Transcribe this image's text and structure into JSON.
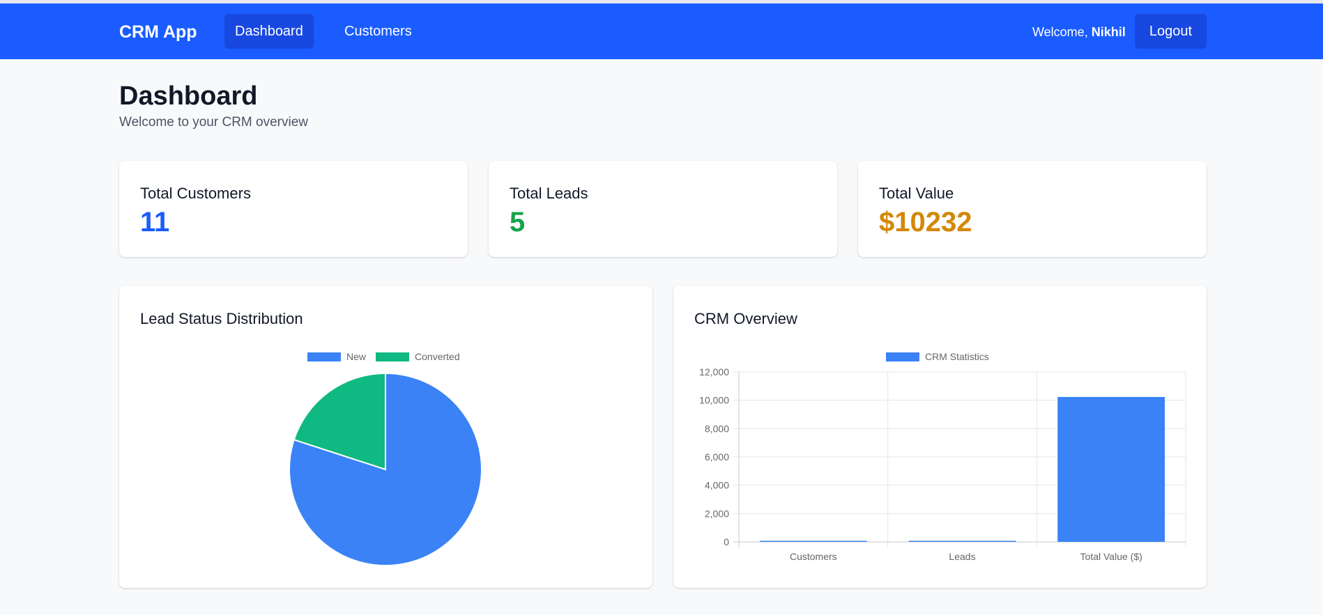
{
  "app": {
    "brand": "CRM App",
    "nav": {
      "dashboard": "Dashboard",
      "customers": "Customers"
    },
    "welcome_prefix": "Welcome,",
    "user_name": "Nikhil",
    "logout_label": "Logout"
  },
  "page": {
    "title": "Dashboard",
    "subtitle": "Welcome to your CRM overview"
  },
  "stats": {
    "customers": {
      "label": "Total Customers",
      "value": "11",
      "color": "#1a5cff"
    },
    "leads": {
      "label": "Total Leads",
      "value": "5",
      "color": "#16a34a"
    },
    "value": {
      "label": "Total Value",
      "value": "$10232",
      "color": "#d48806"
    }
  },
  "colors": {
    "primary": "#1a5cff",
    "pie_new": "#3b82f6",
    "pie_converted": "#10b981",
    "bar": "#3b82f6"
  },
  "chart_data": [
    {
      "type": "pie",
      "title": "Lead Status Distribution",
      "categories": [
        "New",
        "Converted"
      ],
      "values": [
        4,
        1
      ],
      "colors": [
        "#3b82f6",
        "#10b981"
      ],
      "legend": "top"
    },
    {
      "type": "bar",
      "title": "CRM Overview",
      "categories": [
        "Customers",
        "Leads",
        "Total Value ($)"
      ],
      "series": [
        {
          "name": "CRM Statistics",
          "values": [
            11,
            5,
            10232
          ]
        }
      ],
      "ylim": [
        0,
        12000
      ],
      "yticks": [
        0,
        2000,
        4000,
        6000,
        8000,
        10000,
        12000
      ],
      "ytick_labels": [
        "0",
        "2,000",
        "4,000",
        "6,000",
        "8,000",
        "10,000",
        "12,000"
      ],
      "grid": true,
      "legend": "top"
    }
  ]
}
